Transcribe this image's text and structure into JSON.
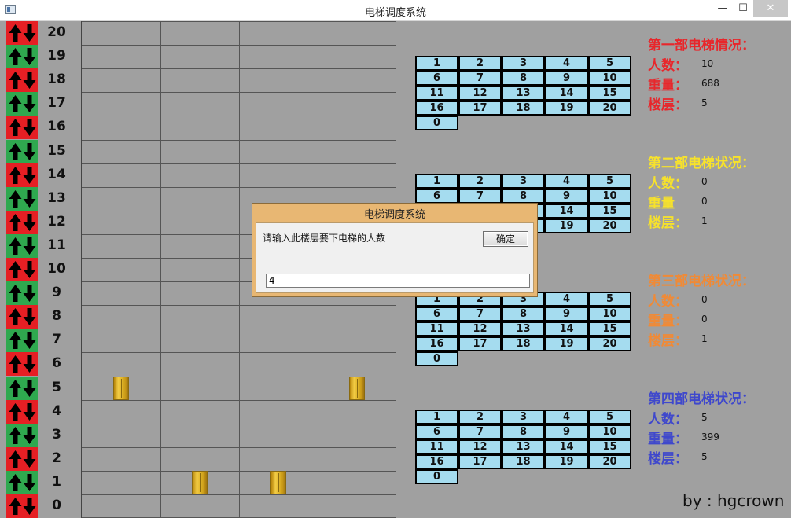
{
  "window": {
    "title": "电梯调度系统",
    "minimize_glyph": "—",
    "maximize_glyph": "☐",
    "close_glyph": "✕"
  },
  "floors": [
    "20",
    "19",
    "18",
    "17",
    "16",
    "15",
    "14",
    "13",
    "12",
    "11",
    "10",
    "9",
    "8",
    "7",
    "6",
    "5",
    "4",
    "3",
    "2",
    "1",
    "0"
  ],
  "elevator_positions": [
    5,
    1,
    1,
    5
  ],
  "keypad_keys": [
    "1",
    "2",
    "3",
    "4",
    "5",
    "6",
    "7",
    "8",
    "9",
    "10",
    "11",
    "12",
    "13",
    "14",
    "15",
    "16",
    "17",
    "18",
    "19",
    "20",
    "0"
  ],
  "elevators": [
    {
      "title": "第一部电梯情况：",
      "color": "#e8262b",
      "people_label": "人数：",
      "people": "10",
      "weight_label": "重量：",
      "weight": "688",
      "floor_label": "楼层：",
      "floor": "5"
    },
    {
      "title": "第二部电梯状况：",
      "color": "#f7e22b",
      "people_label": "人数：",
      "people": "0",
      "weight_label": "重量",
      "weight": "0",
      "floor_label": "楼层：",
      "floor": "1"
    },
    {
      "title": "第三部电梯状况：",
      "color": "#f08a36",
      "people_label": "人数：",
      "people": "0",
      "weight_label": "重量：",
      "weight": "0",
      "floor_label": "楼层：",
      "floor": "1"
    },
    {
      "title": "第四部电梯状况：",
      "color": "#3f48cc",
      "people_label": "人数：",
      "people": "5",
      "weight_label": "重量：",
      "weight": "399",
      "floor_label": "楼层：",
      "floor": "5"
    }
  ],
  "byline": "by : hgcrown",
  "dialog": {
    "title": "电梯调度系统",
    "prompt": "请输入此楼层要下电梯的人数",
    "ok_label": "确定",
    "input_value": "4"
  },
  "colors": {
    "up_red": "#e51f24",
    "up_green": "#2fa84f",
    "key_bg": "#a5dcef",
    "background": "#a0a0a0"
  }
}
